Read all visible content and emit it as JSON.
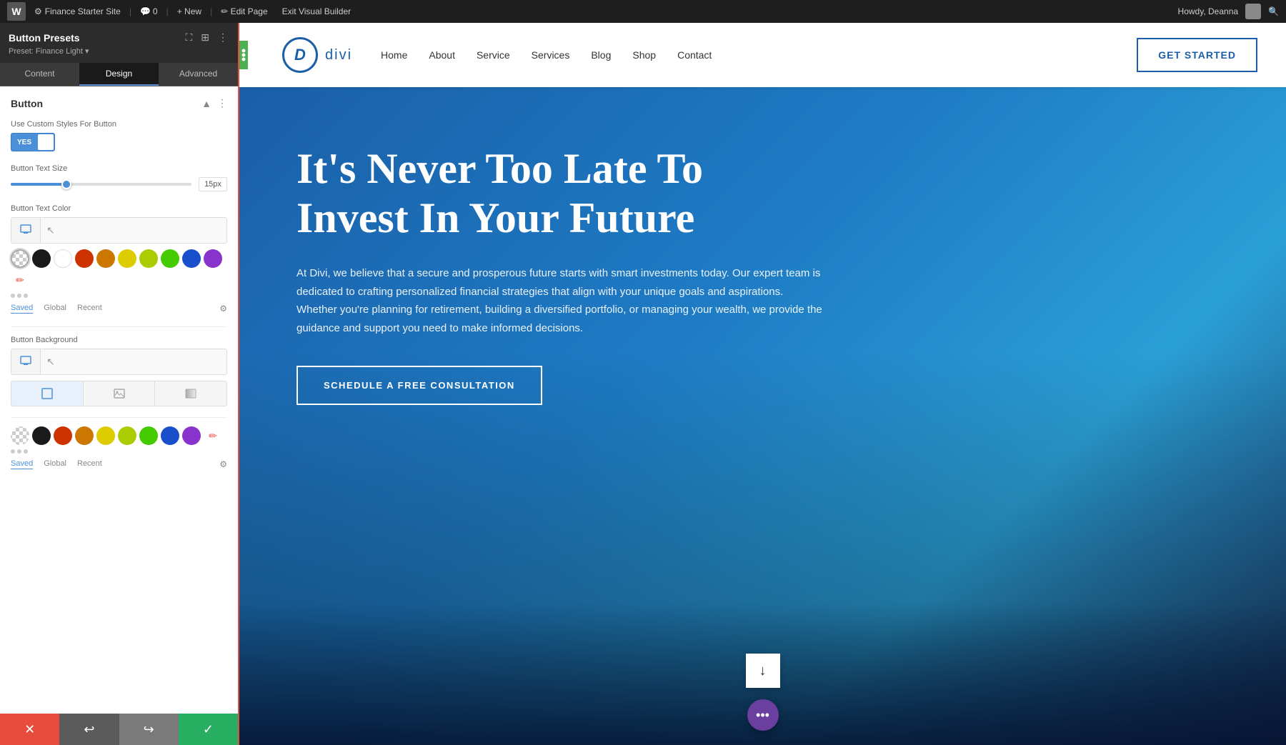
{
  "admin_bar": {
    "wp_icon": "W",
    "site_name": "Finance Starter Site",
    "comment_icon": "💬",
    "comment_count": "0",
    "new_label": "+ New",
    "edit_page_label": "✏ Edit Page",
    "exit_builder_label": "Exit Visual Builder",
    "howdy_label": "Howdy, Deanna",
    "search_icon": "🔍"
  },
  "panel": {
    "title": "Button Presets",
    "subtitle": "Preset: Finance Light ▾",
    "tabs": [
      "Content",
      "Design",
      "Advanced"
    ],
    "active_tab": "Design",
    "section_title": "Button",
    "custom_styles_label": "Use Custom Styles For Button",
    "toggle_yes": "YES",
    "button_text_size_label": "Button Text Size",
    "button_text_size_value": "15px",
    "button_text_color_label": "Button Text Color",
    "button_background_label": "Button Background",
    "color_tabs": [
      "Saved",
      "Global",
      "Recent"
    ],
    "active_color_tab": "Saved",
    "swatches": [
      {
        "color": "transparent",
        "label": "transparent"
      },
      {
        "color": "#1a1a1a",
        "label": "black"
      },
      {
        "color": "#ffffff",
        "label": "white"
      },
      {
        "color": "#cc3300",
        "label": "red"
      },
      {
        "color": "#cc7700",
        "label": "orange"
      },
      {
        "color": "#ddcc00",
        "label": "yellow1"
      },
      {
        "color": "#ccdd00",
        "label": "yellow2"
      },
      {
        "color": "#44cc00",
        "label": "green"
      },
      {
        "color": "#1a4fcc",
        "label": "blue"
      },
      {
        "color": "#8833cc",
        "label": "purple"
      },
      {
        "color": "#e74c3c",
        "label": "pencil"
      }
    ],
    "swatches_bottom": [
      {
        "color": "transparent",
        "label": "transparent"
      },
      {
        "color": "#1a1a1a",
        "label": "black"
      },
      {
        "color": "#cc3300",
        "label": "red"
      },
      {
        "color": "#cc7700",
        "label": "orange"
      },
      {
        "color": "#ddcc00",
        "label": "yellow1"
      },
      {
        "color": "#ccdd00",
        "label": "yellow2"
      },
      {
        "color": "#44cc00",
        "label": "green"
      },
      {
        "color": "#1a4fcc",
        "label": "blue"
      },
      {
        "color": "#8833cc",
        "label": "purple"
      },
      {
        "color": "#e74c3c",
        "label": "pencil"
      }
    ]
  },
  "footer_buttons": {
    "cancel_label": "✕",
    "undo_label": "↩",
    "redo_label": "↪",
    "save_label": "✓"
  },
  "site": {
    "logo_letter": "D",
    "logo_text": "divi",
    "nav_links": [
      "Home",
      "About",
      "Service",
      "Services",
      "Blog",
      "Shop",
      "Contact"
    ],
    "cta_button": "GET STARTED",
    "hero_title": "It's Never Too Late To Invest In Your Future",
    "hero_desc": "At Divi, we believe that a secure and prosperous future starts with smart investments today. Our expert team is dedicated to crafting personalized financial strategies that align with your unique goals and aspirations. Whether you're planning for retirement, building a diversified portfolio, or managing your wealth, we provide the guidance and support you need to make informed decisions.",
    "hero_cta": "SCHEDULE A FREE CONSULTATION",
    "scroll_down_icon": "↓",
    "fab_icon": "···"
  }
}
